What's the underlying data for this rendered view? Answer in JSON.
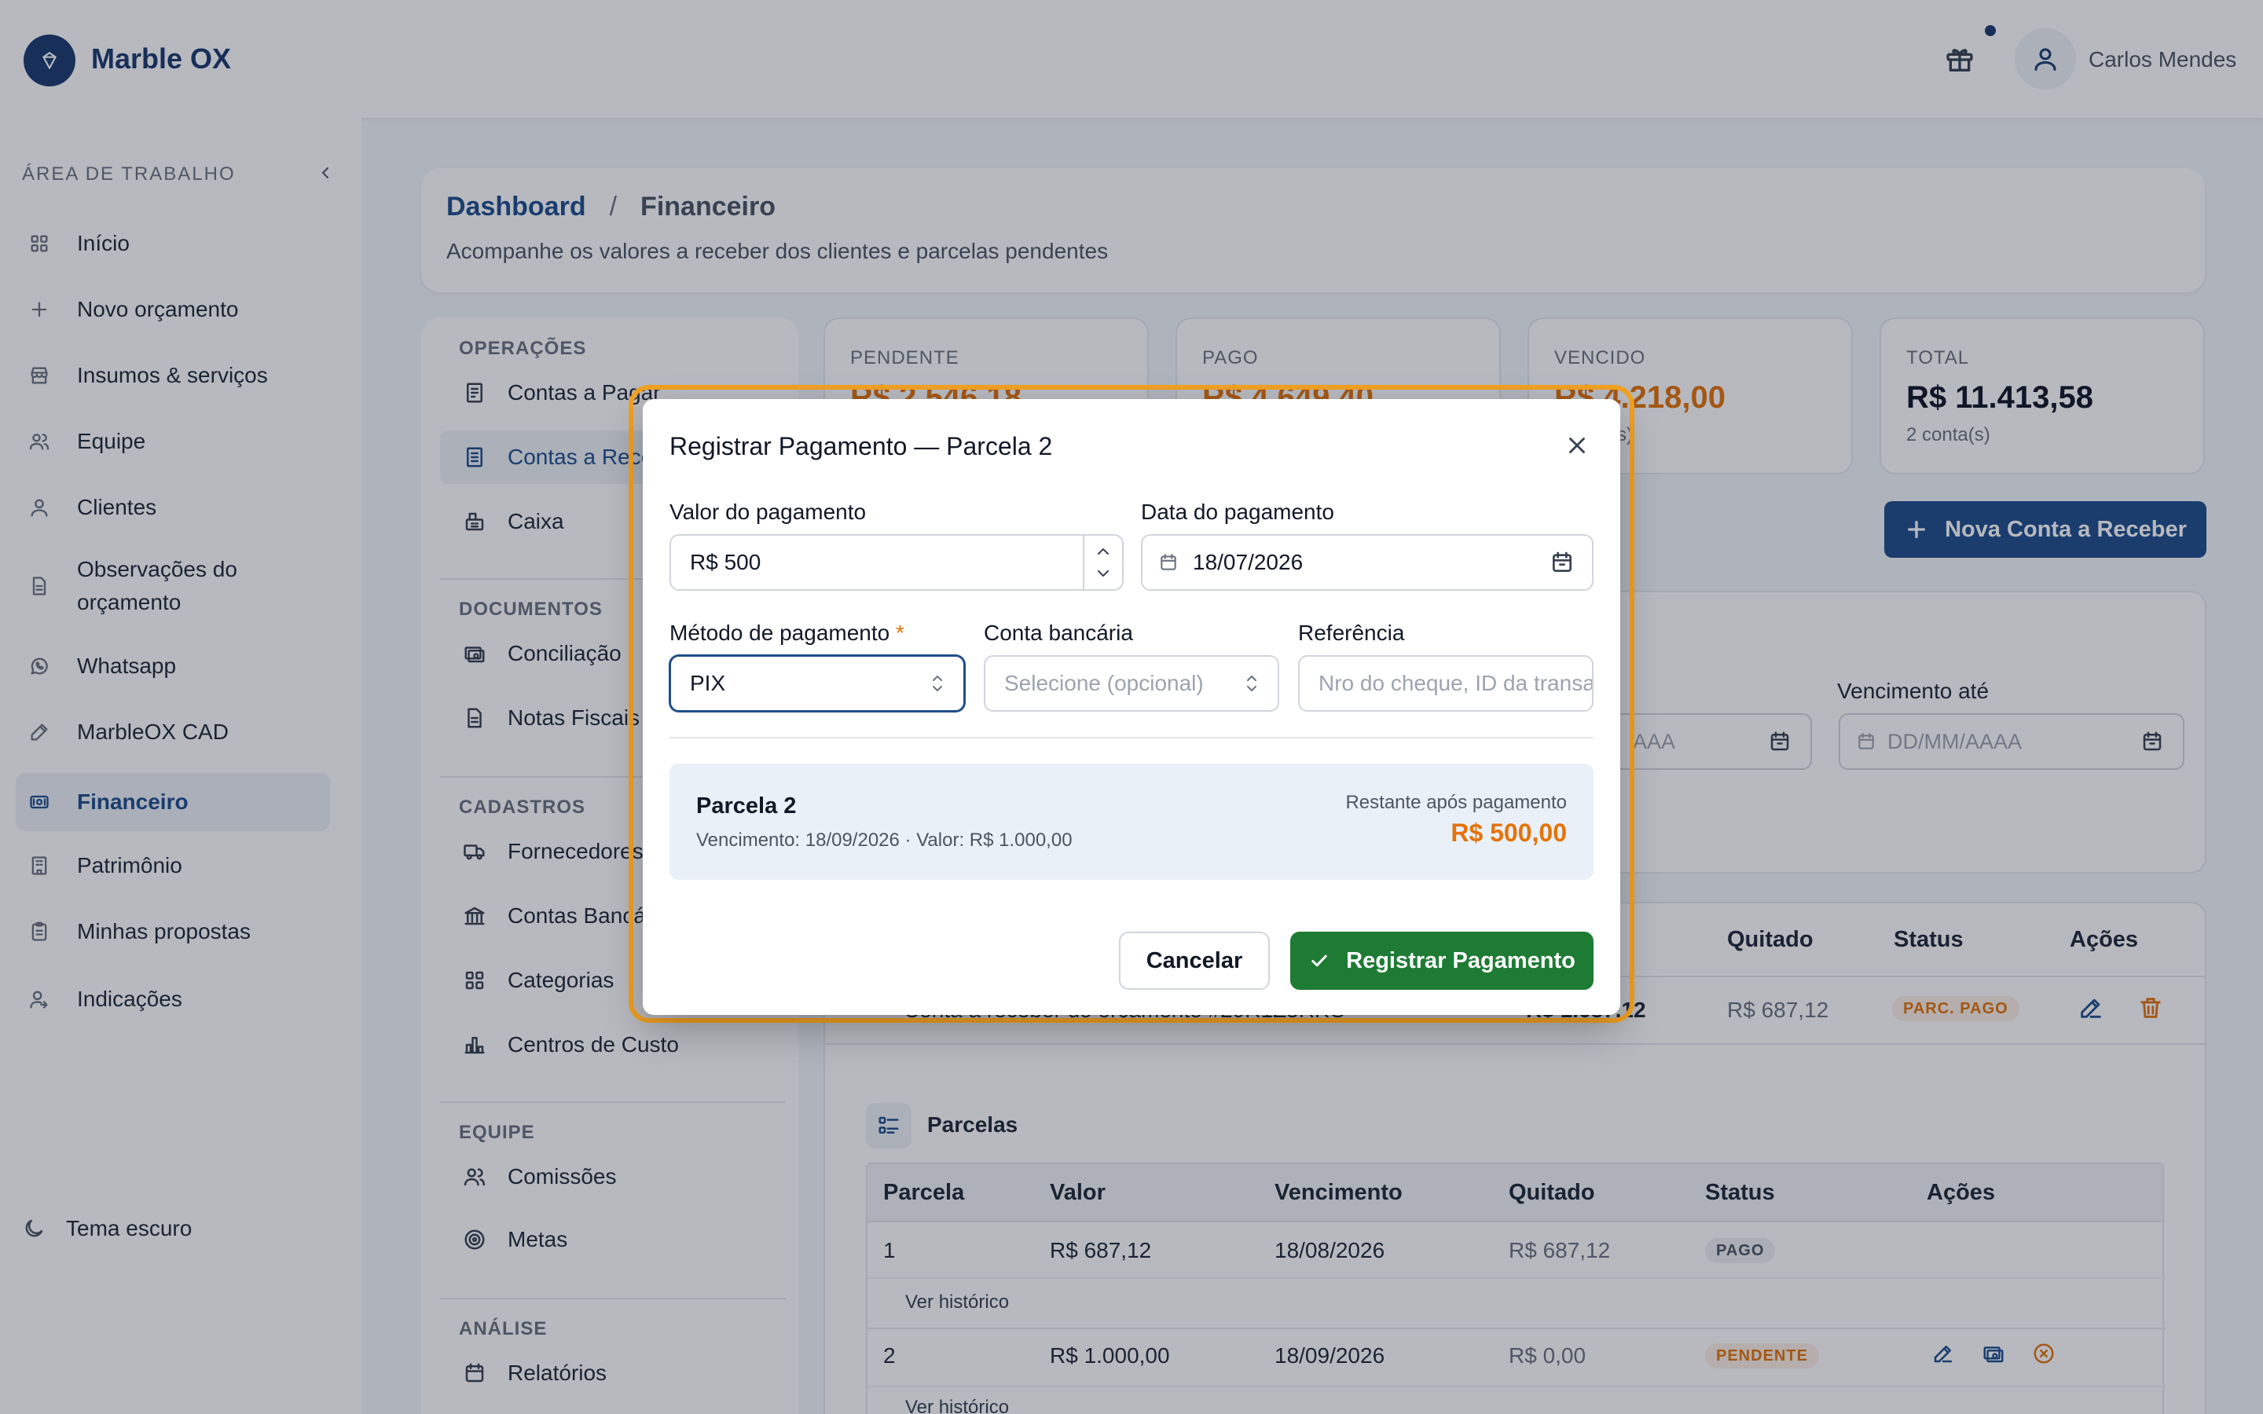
{
  "app": {
    "name": "Marble OX",
    "user_name": "Carlos Mendes"
  },
  "sidebar": {
    "section_title": "ÁREA DE TRABALHO",
    "items": [
      {
        "label": "Início",
        "icon": "grid-icon"
      },
      {
        "label": "Novo orçamento",
        "icon": "plus-icon"
      },
      {
        "label": "Insumos & serviços",
        "icon": "store-icon"
      },
      {
        "label": "Equipe",
        "icon": "users-icon"
      },
      {
        "label": "Clientes",
        "icon": "user-icon"
      },
      {
        "label": "Observações do",
        "label2": "orçamento",
        "icon": "file-text-icon"
      },
      {
        "label": "Whatsapp",
        "icon": "whatsapp-icon"
      },
      {
        "label": "MarbleOX CAD",
        "icon": "pencil-icon"
      },
      {
        "label": "Financeiro",
        "icon": "finance-icon",
        "active": true
      },
      {
        "label": "Patrimônio",
        "icon": "building-icon"
      },
      {
        "label": "Minhas propostas",
        "icon": "clipboard-icon"
      },
      {
        "label": "Indicações",
        "icon": "user-referral-icon"
      }
    ],
    "theme_toggle": "Tema escuro"
  },
  "breadcrumb": {
    "home": "Dashboard",
    "separator": "/",
    "current": "Financeiro",
    "subtitle": "Acompanhe os valores a receber dos clientes e parcelas pendentes"
  },
  "ops_menu": {
    "sections": [
      {
        "title": "OPERAÇÕES",
        "items": [
          "Contas a Pagar",
          "Contas a Receber",
          "Caixa"
        ]
      },
      {
        "title": "DOCUMENTOS",
        "items": [
          "Conciliação",
          "Notas Fiscais"
        ]
      },
      {
        "title": "CADASTROS",
        "items": [
          "Fornecedores",
          "Contas Bancárias",
          "Categorias",
          "Centros de Custo"
        ]
      },
      {
        "title": "EQUIPE",
        "items": [
          "Comissões",
          "Metas"
        ]
      },
      {
        "title": "ANÁLISE",
        "items": [
          "Relatórios"
        ]
      }
    ]
  },
  "stats": [
    {
      "label": "PENDENTE",
      "value": "R$ 2.546,18",
      "count": "",
      "color": "#e3730b"
    },
    {
      "label": "PAGO",
      "value": "R$ 4.649,40",
      "count": "",
      "color": "#e3730b"
    },
    {
      "label": "VENCIDO",
      "value": "R$ 4.218,00",
      "count": "(s)",
      "color": "#e3730b"
    },
    {
      "label": "TOTAL",
      "value": "R$ 11.413,58",
      "count": "2 conta(s)",
      "color": "#111827"
    }
  ],
  "new_button": "Nova Conta a Receber",
  "filters": {
    "due_until_label": "Vencimento até",
    "date_placeholder": "DD/MM/AAAA",
    "partial_placeholder": "AAA"
  },
  "accounts_table": {
    "headers": {
      "quitado": "Quitado",
      "status": "Status",
      "acoes": "Ações"
    },
    "row": {
      "description": "Conta a receber do orçamento #29R1Z5RKO",
      "value": "R$ 1.687,12",
      "quitado": "R$ 687,12",
      "status": "PARC. PAGO"
    }
  },
  "installments": {
    "title": "Parcelas",
    "headers": [
      "Parcela",
      "Valor",
      "Vencimento",
      "Quitado",
      "Status",
      "Ações"
    ],
    "history_link": "Ver histórico",
    "rows": [
      {
        "parcela": "1",
        "valor": "R$ 687,12",
        "vencimento": "18/08/2026",
        "quitado": "R$ 687,12",
        "status": "PAGO"
      },
      {
        "parcela": "2",
        "valor": "R$ 1.000,00",
        "vencimento": "18/09/2026",
        "quitado": "R$ 0,00",
        "status": "PENDENTE"
      }
    ]
  },
  "modal": {
    "title": "Registrar Pagamento — Parcela 2",
    "amount_label": "Valor do pagamento",
    "amount_value": "R$ 500",
    "date_label": "Data do pagamento",
    "date_value": "18/07/2026",
    "method_label": "Método de pagamento",
    "required_mark": "*",
    "method_value": "PIX",
    "bank_label": "Conta bancária",
    "bank_placeholder": "Selecione (opcional)",
    "ref_label": "Referência",
    "ref_placeholder": "Nro do cheque, ID da transação",
    "summary_title": "Parcela 2",
    "summary_sub": "Vencimento: 18/09/2026 · Valor: R$ 1.000,00",
    "remaining_label": "Restante após pagamento",
    "remaining_value": "R$ 500,00",
    "cancel": "Cancelar",
    "submit": "Registrar Pagamento"
  },
  "colors": {
    "brand": "#1a3a6e",
    "accent": "#1f4e8c",
    "warning": "#e3730b",
    "success": "#1e7b34",
    "focus_ring": "#f2a122"
  }
}
